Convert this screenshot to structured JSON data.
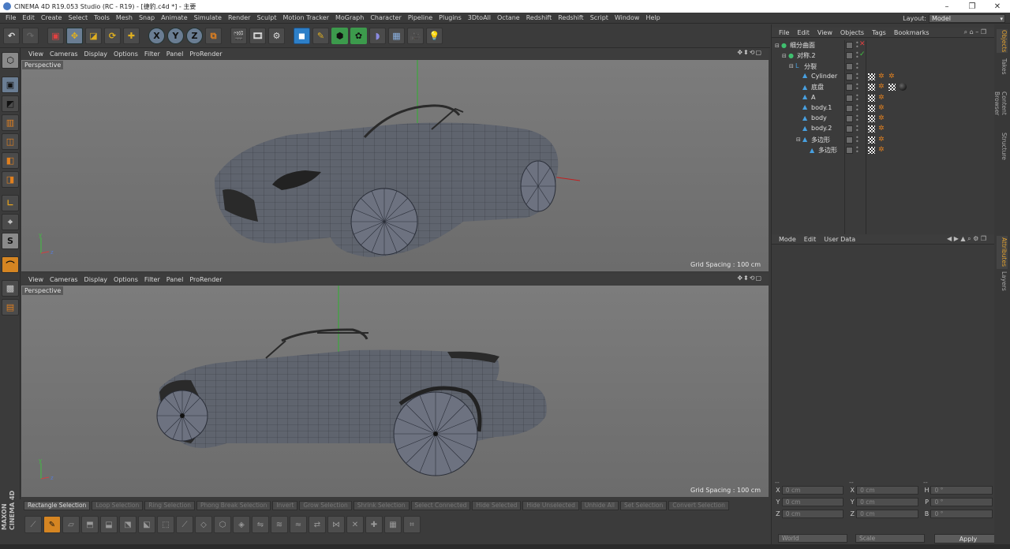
{
  "window": {
    "title": "CINEMA 4D R19.053 Studio (RC - R19) - [捷豹.c4d *] - 主要"
  },
  "menu": [
    "File",
    "Edit",
    "Create",
    "Select",
    "Tools",
    "Mesh",
    "Snap",
    "Animate",
    "Simulate",
    "Render",
    "Sculpt",
    "Motion Tracker",
    "MoGraph",
    "Character",
    "Pipeline",
    "Plugins",
    "3DtoAll",
    "Octane",
    "Redshift",
    "Redshift",
    "Script",
    "Window",
    "Help"
  ],
  "layout": {
    "label": "Layout:",
    "value": "Model"
  },
  "toolbar": {
    "axis_x": "X",
    "axis_y": "Y",
    "axis_z": "Z"
  },
  "leftbar": {
    "brand_top": "MAXON",
    "brand_bottom": "CINEMA 4D",
    "s_label": "S"
  },
  "viewport_menu": [
    "View",
    "Cameras",
    "Display",
    "Options",
    "Filter",
    "Panel",
    "ProRender"
  ],
  "viewports": [
    {
      "label": "Perspective",
      "grid_spacing": "Grid Spacing : 100 cm"
    },
    {
      "label": "Perspective",
      "grid_spacing": "Grid Spacing : 100 cm"
    }
  ],
  "selection_tools": [
    {
      "label": "Rectangle Selection",
      "active": true
    },
    {
      "label": "Loop Selection",
      "active": false
    },
    {
      "label": "Ring Selection",
      "active": false
    },
    {
      "label": "Phong Break Selection",
      "active": false
    },
    {
      "label": "Invert",
      "active": false
    },
    {
      "label": "Grow Selection",
      "active": false
    },
    {
      "label": "Shrink Selection",
      "active": false
    },
    {
      "label": "Select Connected",
      "active": false
    },
    {
      "label": "Hide Selected",
      "active": false
    },
    {
      "label": "Hide Unselected",
      "active": false
    },
    {
      "label": "Unhide All",
      "active": false
    },
    {
      "label": "Set Selection",
      "active": false
    },
    {
      "label": "Convert Selection",
      "active": false
    }
  ],
  "objects_panel": {
    "menu": [
      "File",
      "Edit",
      "View",
      "Objects",
      "Tags",
      "Bookmarks"
    ],
    "items": [
      {
        "name": "细分曲面",
        "depth": 0,
        "icon": "subdivision-icon"
      },
      {
        "name": "对称.2",
        "depth": 1,
        "icon": "symmetry-icon"
      },
      {
        "name": "分裂",
        "depth": 2,
        "icon": "null-icon"
      },
      {
        "name": "Cylinder",
        "depth": 3,
        "icon": "polygon-icon"
      },
      {
        "name": "底盘",
        "depth": 3,
        "icon": "polygon-icon"
      },
      {
        "name": "A",
        "depth": 3,
        "icon": "polygon-icon"
      },
      {
        "name": "body.1",
        "depth": 3,
        "icon": "polygon-icon"
      },
      {
        "name": "body",
        "depth": 3,
        "icon": "polygon-icon"
      },
      {
        "name": "body.2",
        "depth": 3,
        "icon": "polygon-icon"
      },
      {
        "name": "多边形",
        "depth": 3,
        "icon": "polygon-icon"
      },
      {
        "name": "多边形",
        "depth": 4,
        "icon": "polygon-icon"
      }
    ]
  },
  "attributes_panel": {
    "menu": [
      "Mode",
      "Edit",
      "User Data"
    ]
  },
  "side_tabs": [
    "Objects",
    "Takes",
    "Content Browser",
    "Structure",
    "Attributes",
    "Layers"
  ],
  "coordinates": {
    "headers": [
      "--",
      "--",
      "--"
    ],
    "rows": [
      {
        "l1": "X",
        "v1": "0 cm",
        "l2": "X",
        "v2": "0 cm",
        "l3": "H",
        "v3": "0 °"
      },
      {
        "l1": "Y",
        "v1": "0 cm",
        "l2": "Y",
        "v2": "0 cm",
        "l3": "P",
        "v3": "0 °"
      },
      {
        "l1": "Z",
        "v1": "0 cm",
        "l2": "Z",
        "v2": "0 cm",
        "l3": "B",
        "v3": "0 °"
      }
    ],
    "mode": "World",
    "transform": "Scale",
    "apply": "Apply"
  },
  "colors": {
    "accent": "#d58522",
    "viewport_bg": "#767676",
    "panel_bg": "#3b3b3b",
    "highlight": "#2d7fc8"
  }
}
